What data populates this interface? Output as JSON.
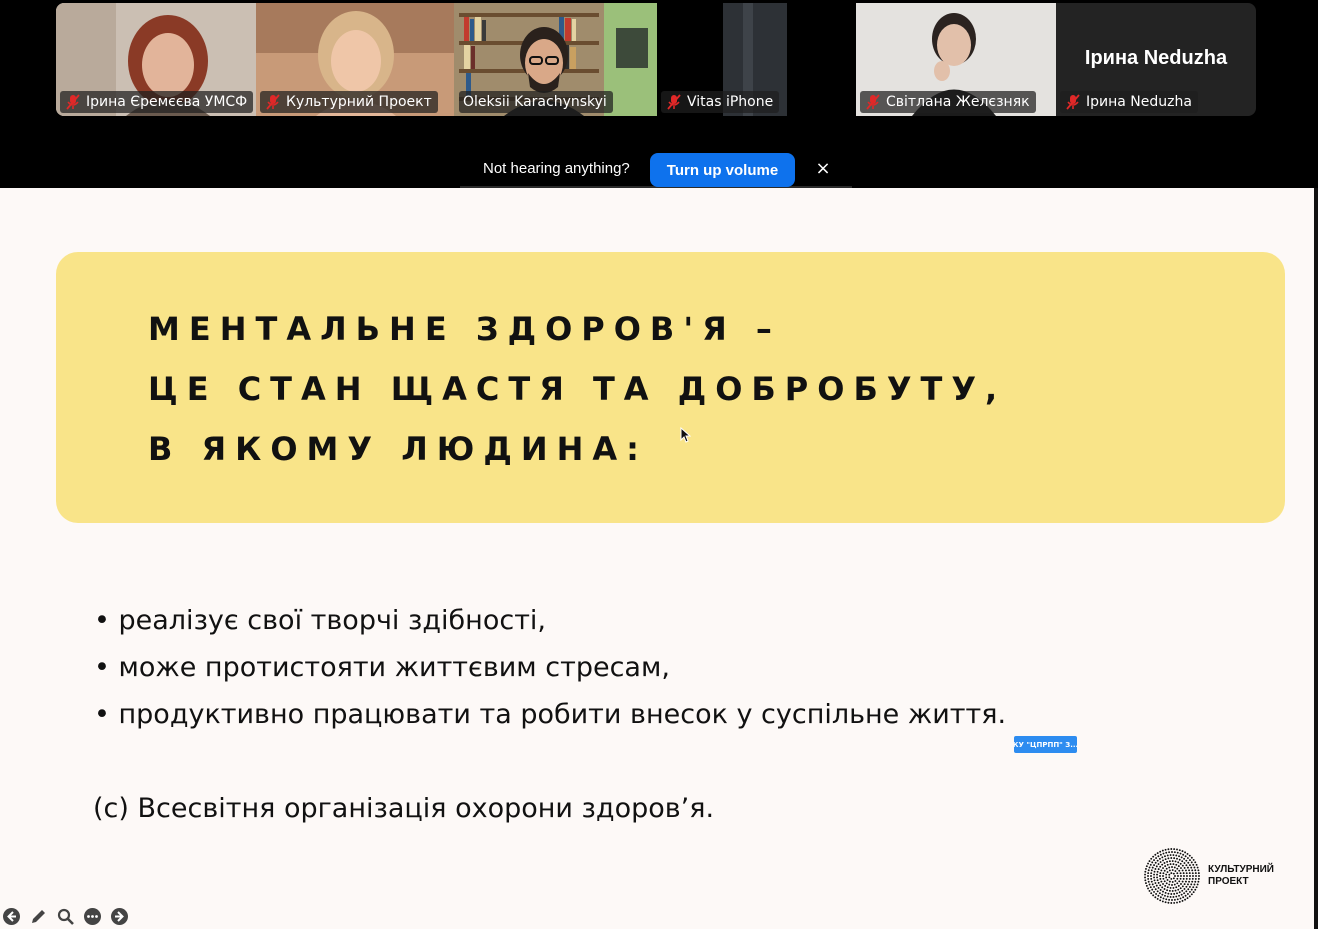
{
  "participants": [
    {
      "name": "Ірина Єремєєва УМСФ",
      "muted": true,
      "active": false
    },
    {
      "name": "Культурний Проект",
      "muted": true,
      "active": false
    },
    {
      "name": "Oleksii Karachynskyi",
      "muted": false,
      "active": true
    },
    {
      "name": "Vitas iPhone",
      "muted": true,
      "active": false
    },
    {
      "name": "Світлана Желєзняк",
      "muted": true,
      "active": false
    },
    {
      "name": "Ірина  Neduzha",
      "muted": true,
      "active": false,
      "display_name": "Ірина  Neduzha"
    }
  ],
  "banner": {
    "message": "Not hearing anything?",
    "button_label": "Turn up volume",
    "close_label": "×"
  },
  "slide": {
    "heading": [
      "МЕНТАЛЬНЕ ЗДОРОВ'Я –",
      "ЦЕ СТАН ЩАСТЯ ТА ДОБРОБУТУ,",
      "В ЯКОМУ ЛЮДИНА:"
    ],
    "bullets": [
      "• реалізує свої творчі здібності,",
      "• може протистояти життєвим стресам,",
      "• продуктивно працювати та робити внесок у суспільне життя."
    ],
    "source": "(с) Всесвітня організація охорони здоров’я.",
    "badge": "КУ \"ЦПРПП\" З...",
    "logo_line1": "КУЛЬТУРНИЙ",
    "logo_line2": "ПРОЕКТ"
  },
  "colors": {
    "highlight_yellow": "#f9e489",
    "active_speaker": "#23d95a",
    "button_blue": "#0e72ed",
    "mic_muted_red": "#e02828"
  },
  "icons": {
    "mic": "microphone-muted-icon",
    "close": "close-icon",
    "tools": [
      "arrow-left-icon",
      "pencil-icon",
      "zoom-icon",
      "more-icon",
      "arrow-right-icon"
    ]
  }
}
